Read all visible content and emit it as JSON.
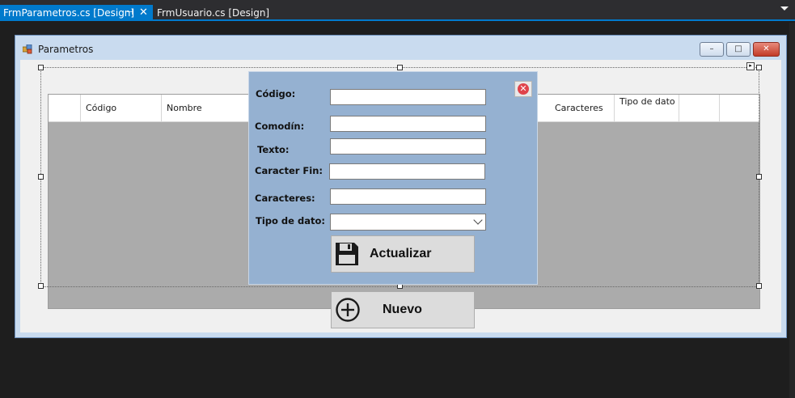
{
  "tabs": [
    {
      "label": "FrmParametros.cs [Design]",
      "active": true
    },
    {
      "label": "FrmUsuario.cs [Design]",
      "active": false
    }
  ],
  "tab_pin_icon": "⊣",
  "tab_close_icon": "✕",
  "form": {
    "title": "Parametros",
    "caption_min": "–",
    "caption_max": "□",
    "caption_close": "✕"
  },
  "grid": {
    "columns": [
      "",
      "Código",
      "Nombre",
      "Caracteres",
      "Tipo de dato",
      "",
      ""
    ],
    "smart_tag": "▸"
  },
  "edit_panel": {
    "close_icon": "✕",
    "fields": [
      {
        "label": "Código:",
        "value": ""
      },
      {
        "label": "Comodín:",
        "value": ""
      },
      {
        "label": "Texto:",
        "value": ""
      },
      {
        "label": "Caracter Fin:",
        "value": ""
      },
      {
        "label": "Caracteres:",
        "value": ""
      },
      {
        "label": "Tipo de dato:",
        "value": ""
      }
    ],
    "update_button": "Actualizar"
  },
  "new_button": "Nuevo",
  "colors": {
    "vs_accent": "#007acc",
    "panel_bg": "#95b1d1",
    "grid_bg": "#ababab"
  }
}
